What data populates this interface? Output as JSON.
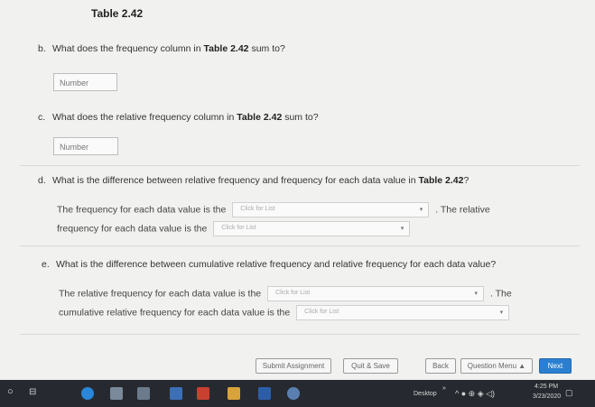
{
  "header": {
    "title": "Table 2.42"
  },
  "question_b": {
    "letter": "b.",
    "text_pre": "What does the frequency column in",
    "table_ref": "Table 2.42",
    "text_post": "sum to?",
    "input_placeholder": "Number"
  },
  "question_c": {
    "letter": "c.",
    "text_pre": "What does the relative frequency column in",
    "table_ref": "Table 2.42",
    "text_post": "sum to?",
    "input_placeholder": "Number"
  },
  "question_d": {
    "letter": "d.",
    "text_pre": "What is the difference between relative frequency and frequency for each data value in",
    "table_ref": "Table 2.42",
    "text_post": "?",
    "line1_pre": "The frequency for each data value is the",
    "dropdown1_placeholder": "Click for List",
    "line1_post": ". The relative",
    "line2_pre": "frequency for each data value is the",
    "dropdown2_placeholder": "Click for List"
  },
  "question_e": {
    "letter": "e.",
    "text": "What is the difference between cumulative relative frequency and relative frequency for each data value?",
    "line1_pre": "The relative frequency for each data value is the",
    "dropdown1_placeholder": "Click for List",
    "line1_post": ". The",
    "line2_pre": "cumulative relative frequency for each data value is the",
    "dropdown2_placeholder": "Click for List"
  },
  "footer_buttons": {
    "submit": "Submit Assignment",
    "quit": "Quit & Save",
    "back": "Back",
    "question_menu": "Question Menu ▲",
    "next": "Next"
  },
  "taskbar": {
    "desktop_label": "Desktop",
    "chevron": "»",
    "time": "4:25 PM",
    "date": "3/23/2020"
  },
  "colors": {
    "next_button": "#2b7fd0",
    "taskbar": "#262a30"
  }
}
